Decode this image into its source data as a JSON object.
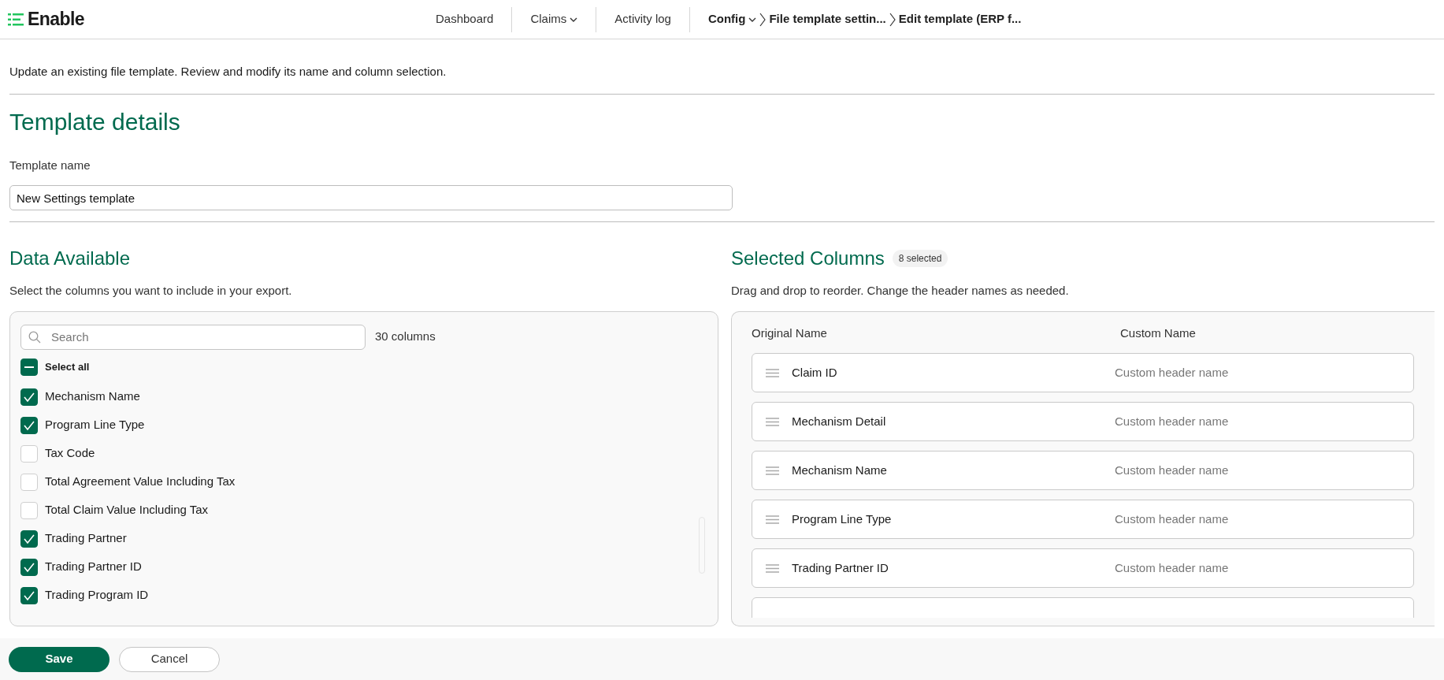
{
  "header": {
    "logo": "Enable",
    "nav": [
      {
        "label": "Dashboard",
        "dropdown": false
      },
      {
        "label": "Claims",
        "dropdown": true
      },
      {
        "label": "Activity log",
        "dropdown": false
      }
    ],
    "breadcrumb": [
      {
        "label": "Config",
        "dropdown": true
      },
      {
        "label": "File template settin...",
        "dropdown": false
      },
      {
        "label": "Edit template (ERP f...",
        "dropdown": false
      }
    ]
  },
  "description": "Update an existing file template. Review and modify its name and column selection.",
  "details": {
    "title": "Template details",
    "name_label": "Template name",
    "name_value": "New Settings template"
  },
  "available": {
    "title": "Data Available",
    "description": "Select the columns you want to include in your export.",
    "search_placeholder": "Search",
    "count": "30 columns",
    "select_all": {
      "label": "Select all",
      "indeterminate": true
    },
    "items": [
      {
        "label": "Mechanism Name",
        "checked": true
      },
      {
        "label": "Program Line Type",
        "checked": true
      },
      {
        "label": "Tax Code",
        "checked": false
      },
      {
        "label": "Total Agreement Value Including Tax",
        "checked": false
      },
      {
        "label": "Total Claim Value Including Tax",
        "checked": false
      },
      {
        "label": "Trading Partner",
        "checked": true
      },
      {
        "label": "Trading Partner ID",
        "checked": true
      },
      {
        "label": "Trading Program ID",
        "checked": true
      }
    ]
  },
  "selected": {
    "title": "Selected Columns",
    "badge": "8 selected",
    "description": "Drag and drop to reorder. Change the header names as needed.",
    "col_original": "Original Name",
    "col_custom": "Custom Name",
    "rows": [
      {
        "name": "Claim ID",
        "placeholder": "Custom header name"
      },
      {
        "name": "Mechanism Detail",
        "placeholder": "Custom header name"
      },
      {
        "name": "Mechanism Name",
        "placeholder": "Custom header name"
      },
      {
        "name": "Program Line Type",
        "placeholder": "Custom header name"
      },
      {
        "name": "Trading Partner ID",
        "placeholder": "Custom header name"
      }
    ]
  },
  "footer": {
    "save": "Save",
    "cancel": "Cancel"
  }
}
